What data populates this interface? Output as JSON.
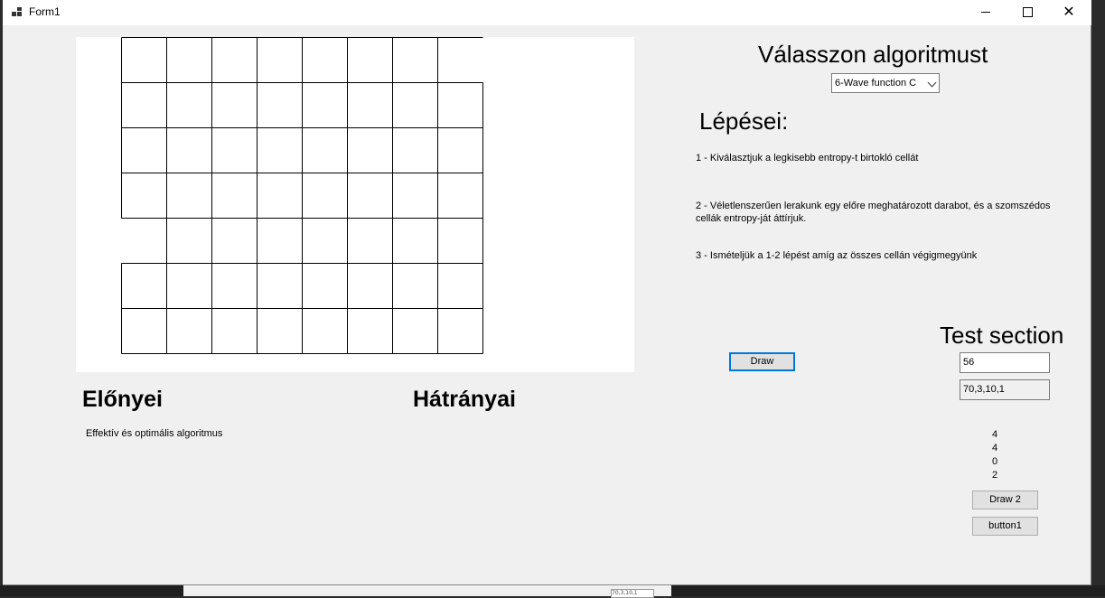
{
  "window": {
    "title": "Form1",
    "minimize": "minimize",
    "maximize": "maximize",
    "close": "✕"
  },
  "algorithm": {
    "heading": "Válasszon algoritmust",
    "selected": "6-Wave function C"
  },
  "steps": {
    "heading": "Lépései:",
    "items": [
      "1 - Kiválasztjuk a legkisebb entropy-t birtokló cellát",
      "2 - Véletlenszerűen lerakunk egy előre meghatározott darabot, és a szomszédos cellák entropy-ját áttírjuk.",
      "3 - Ismételjük a 1-2 lépést amíg az összes cellán végigmegyünk"
    ]
  },
  "buttons": {
    "draw": "Draw",
    "draw2": "Draw 2",
    "button1": "button1"
  },
  "test": {
    "heading": "Test section",
    "input1": "56",
    "input2": "70,3,10,1",
    "outputs": [
      "4",
      "4",
      "0",
      "2"
    ]
  },
  "pros": {
    "heading": "Előnyei",
    "text": "Effektív és optimális algoritmus"
  },
  "cons": {
    "heading": "Hátrányai"
  },
  "background_window": {
    "box_text": "70,3,10,1"
  },
  "grid": {
    "rows": 7,
    "cols": 8
  }
}
